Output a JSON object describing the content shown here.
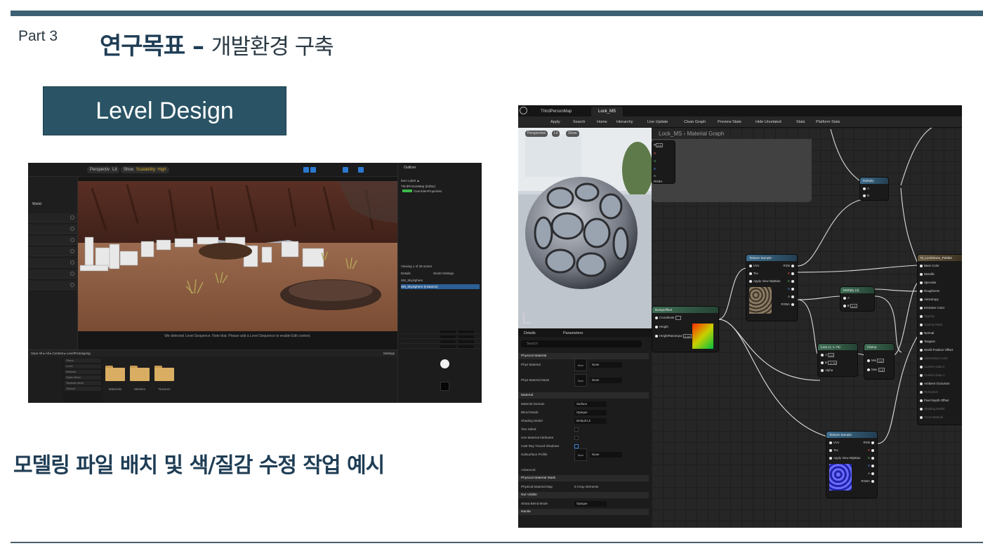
{
  "slide": {
    "part": "Part 3",
    "title_main": "연구목표",
    "title_dash": " – ",
    "title_sub": "개발환경 구축",
    "section_label": "Level Design",
    "caption": "모델링 파일 배치 및 색/질감 수정 작업 예시"
  },
  "level_editor": {
    "viewport_chips": [
      "Perspective",
      "Lit",
      "Show"
    ],
    "scalability": "Scalability: High",
    "outliner_title": "Outliner",
    "outliner_rows": [
      "Item Label ▲",
      "ThirdPersonMap (Editor)",
      "OverridenProperties"
    ],
    "details_rows": [
      "Viewing 1 of 39 actors",
      "Details",
      "World Settings"
    ],
    "selected_actor": "SM_SkySphere",
    "selected_actor_instance": "SM_SkySphere (Instance)",
    "viewport_message": "We detected Level Sequence. Note that: Please add a Level Sequence to enable Edit context.",
    "content_path": "Save All  ▸  All  ▸  Content  ▸  LevelPrototyping",
    "filters": [
      "Filters",
      "Level",
      "Material",
      "Static Mesh",
      "Skeletal Mesh",
      "Texture"
    ],
    "folders": [
      "Materials",
      "Meshes",
      "Textures"
    ],
    "settings_label": "Settings",
    "sidebar_heading": "World"
  },
  "material_editor": {
    "tabs": [
      "ThirdPersonMap",
      "Lock_MS"
    ],
    "toolbar": [
      "Apply",
      "Search",
      "Home",
      "Hierarchy",
      "Live Update",
      "Clean Graph",
      "Preview State",
      "Hide Unrelated",
      "Stats",
      "Platform Stats"
    ],
    "preview_chips": [
      "Perspective",
      "Lit",
      "Show"
    ],
    "breadcrumb": "Lock_MS  ›  Material Graph",
    "details_tabs": [
      "Details",
      "Parameters"
    ],
    "search_placeholder": "Search",
    "details": [
      {
        "type": "section",
        "label": "Physical Material"
      },
      {
        "type": "thumb",
        "label": "Phys Material",
        "value": "None"
      },
      {
        "type": "thumb",
        "label": "Phys Material Mask",
        "value": "None"
      },
      {
        "type": "section",
        "label": "Material"
      },
      {
        "type": "drop",
        "label": "Material Domain",
        "value": "Surface"
      },
      {
        "type": "drop",
        "label": "Blend Mode",
        "value": "Opaque"
      },
      {
        "type": "drop",
        "label": "Shading Model",
        "value": "Default Lit"
      },
      {
        "type": "check",
        "label": "Two Sided",
        "value": ""
      },
      {
        "type": "check",
        "label": "Use Material Attributes",
        "value": ""
      },
      {
        "type": "checkon",
        "label": "Cast Ray Traced Shadows",
        "value": ""
      },
      {
        "type": "thumb",
        "label": "Subsurface Profile",
        "value": "None"
      },
      {
        "type": "sub",
        "label": "Advanced",
        "value": ""
      },
      {
        "type": "section",
        "label": "Physical Material Mask"
      },
      {
        "type": "text",
        "label": "Physical Material Map",
        "value": "8 Array elements"
      },
      {
        "type": "section",
        "label": "Nut Visible"
      },
      {
        "type": "drop",
        "label": "Strata Blend Mode",
        "value": "Opaque"
      },
      {
        "type": "section",
        "label": "Nanite"
      }
    ],
    "nodes": {
      "multiply1": {
        "title": "Multiply",
        "pins": [
          "A",
          "B"
        ]
      },
      "texsample1": {
        "title": "Texture Sample",
        "inputs": [
          "UVs",
          "Tex",
          "Apply View MipBias"
        ],
        "outputs": [
          "RGB",
          "R",
          "G",
          "B",
          "A",
          "RGBA"
        ]
      },
      "multiply2": {
        "title": "Multiply (4)",
        "pins": [
          "A",
          "B"
        ],
        "b_value": "4.0"
      },
      "bumpoffset": {
        "title": "BumpOffset",
        "pins": [
          "Coordinate",
          "Height",
          "HeightRatioInput"
        ],
        "ratio_value": "0.16"
      },
      "lerp": {
        "title": "Lerp (1,-1.75)",
        "pins": [
          "A",
          "B",
          "Alpha"
        ],
        "a_value": "1.0",
        "b_value": "-1.75"
      },
      "clamp": {
        "title": "Clamp",
        "pins": [
          "Min",
          "Max"
        ],
        "min_value": "0.0",
        "max_value": "1.0"
      },
      "texsample2": {
        "title": "Texture Sample",
        "inputs": [
          "UVs",
          "Tex",
          "Apply View MipBias"
        ],
        "outputs": [
          "RGB",
          "R",
          "G",
          "B",
          "A",
          "RGBA"
        ]
      },
      "result": {
        "title": "M_LockStone_Pebble",
        "pins": [
          "Base Color",
          "Metallic",
          "Specular",
          "Roughness",
          "Anisotropy",
          "Emissive Color",
          "Opacity",
          "Opacity Mask",
          "Normal",
          "Tangent",
          "World Position Offset",
          "Subsurface Color",
          "Custom Data 0",
          "Custom Data 1",
          "Ambient Occlusion",
          "Refraction",
          "Pixel Depth Offset",
          "Shading Model",
          "Front Material"
        ]
      },
      "fragment": {
        "pins": [
          "R",
          "G",
          "B",
          "A",
          "RGBA"
        ],
        "value": "0.5"
      }
    }
  }
}
